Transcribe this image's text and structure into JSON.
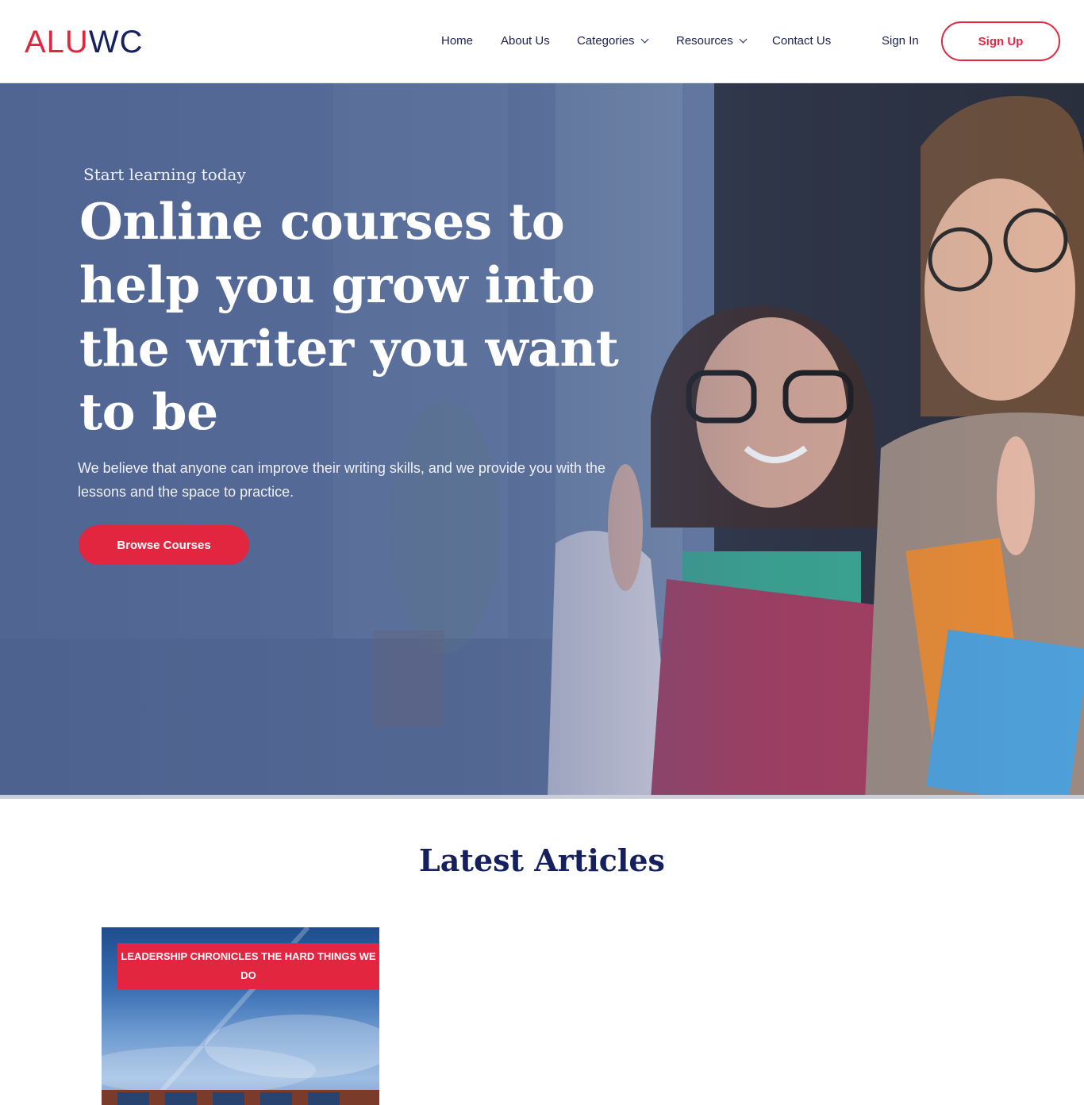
{
  "header": {
    "logo_part1": "ALU",
    "logo_part2": "WC",
    "nav": {
      "home": "Home",
      "about": "About Us",
      "categories": "Categories",
      "resources": "Resources",
      "contact": "Contact Us"
    },
    "sign_in": "Sign In",
    "sign_up": "Sign Up"
  },
  "hero": {
    "eyebrow": "Start learning today",
    "title": "Online courses to help you grow into the writer you want to be",
    "text": "We believe that anyone can improve their writing skills, and we provide you with the lessons and the space to practice.",
    "cta": "Browse Courses"
  },
  "latest": {
    "title": "Latest Articles",
    "articles": [
      {
        "title": "LEADERSHIP CHRONICLES THE HARD THINGS WE DO"
      }
    ]
  },
  "colors": {
    "brand_red": "#e3263f",
    "brand_navy": "#15205e"
  }
}
